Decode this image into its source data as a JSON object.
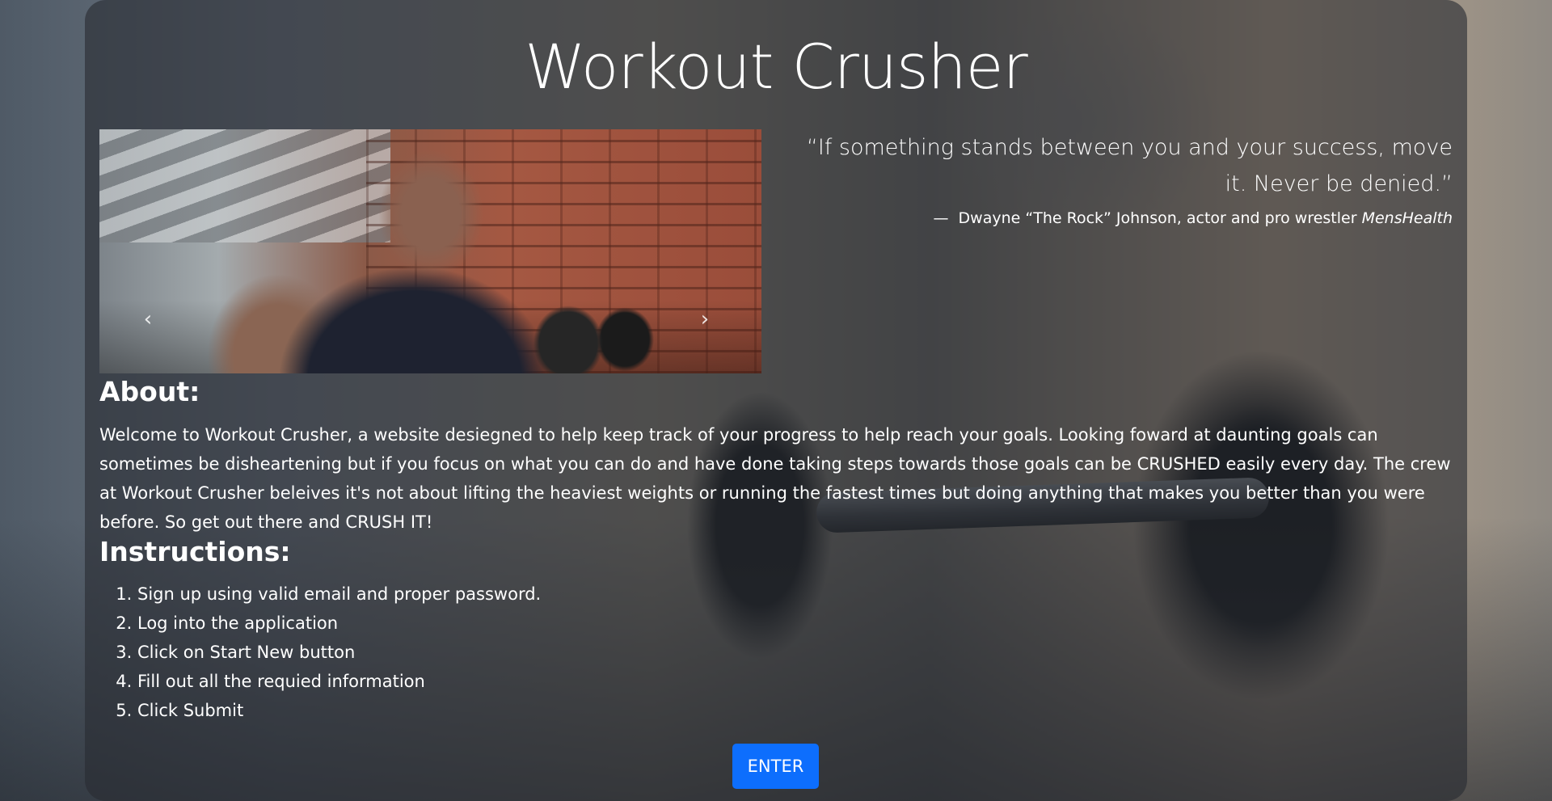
{
  "title": "Workout Crusher",
  "carousel": {
    "prev_label": "‹",
    "next_label": "›"
  },
  "quote": {
    "text": "“If something stands between you and your success, move it. Never be denied.”",
    "attribution": "Dwayne “The Rock” Johnson, actor and pro wrestler",
    "source": "MensHealth",
    "dash": "—"
  },
  "about": {
    "heading": "About:",
    "body": "Welcome to Workout Crusher, a website desiegned to help keep track of your progress to help reach your goals. Looking foward at daunting goals can sometimes be disheartening but if you focus on what you can do and have done taking steps towards those goals can be CRUSHED easily every day. The crew at Workout Crusher beleives it's not about lifting the heaviest weights or running the fastest times but doing anything that makes you better than you were before. So get out there and CRUSH IT!"
  },
  "instructions": {
    "heading": "Instructions:",
    "steps": [
      "Sign up using valid email and proper password.",
      "Log into the application",
      "Click on Start New button",
      "Fill out all the requied information",
      "Click Submit"
    ]
  },
  "enter_button": "ENTER",
  "colors": {
    "accent": "#0d6efd"
  }
}
